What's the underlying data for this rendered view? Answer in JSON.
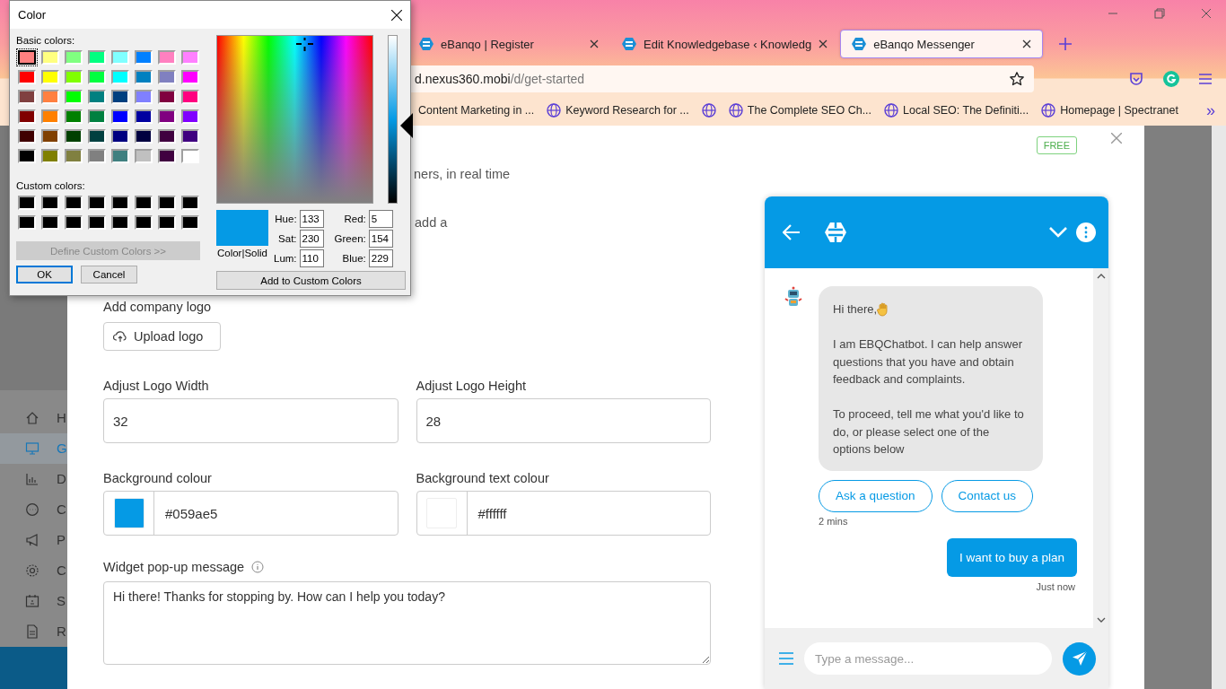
{
  "browser": {
    "tabs": [
      {
        "title": "eBanqo | Register",
        "selected": false
      },
      {
        "title": "Edit Knowledgebase ‹ Knowledg",
        "selected": false
      },
      {
        "title": "eBanqo Messenger",
        "selected": true
      }
    ],
    "address": {
      "host": "d.nexus360.mobi",
      "path": "/d/get-started"
    },
    "bookmarks": [
      {
        "kind": "text",
        "label": "Content Marketing in ..."
      },
      {
        "kind": "globe",
        "label": "Keyword Research for ..."
      },
      {
        "kind": "globe-only"
      },
      {
        "kind": "globe",
        "label": "The Complete SEO Ch..."
      },
      {
        "kind": "globe",
        "label": "Local SEO: The Definiti..."
      },
      {
        "kind": "globe",
        "label": "Homepage | Spectranet"
      }
    ],
    "overflow": "»"
  },
  "sidebar": {
    "items": [
      {
        "label": "H",
        "selected": false
      },
      {
        "label": "G",
        "selected": true
      },
      {
        "label": "D",
        "selected": false
      },
      {
        "label": "C",
        "selected": false
      },
      {
        "label": "P",
        "selected": false
      },
      {
        "label": "C",
        "selected": false
      },
      {
        "label": "S",
        "selected": false
      },
      {
        "label": "R",
        "selected": false
      }
    ]
  },
  "modal": {
    "badge": "FREE",
    "intro_fragments": [
      "ners, in real time",
      "add a"
    ],
    "logo_label": "Add company logo",
    "upload_button": "Upload logo",
    "size_fields": [
      {
        "label": "Adjust Logo Width",
        "value": "32"
      },
      {
        "label": "Adjust Logo Height",
        "value": "28"
      }
    ],
    "color_fields": [
      {
        "label": "Background colour",
        "value": "#059ae5",
        "color": "#059ae5"
      },
      {
        "label": "Background text colour",
        "value": "#ffffff",
        "color": "#ffffff"
      }
    ],
    "message_field": {
      "label": "Widget pop-up message",
      "value": "Hi there! Thanks for stopping by. How can I help you today?"
    }
  },
  "chat": {
    "bot_message": [
      "Hi there,",
      "I am EBQChatbot. I can help answer questions that you have and obtain feedback and complaints.",
      "To proceed, tell me what you'd like to do, or please select one of the options below"
    ],
    "quick_replies": [
      "Ask a question",
      "Contact us"
    ],
    "bot_time": "2 mins",
    "user_message": "I want to buy a plan",
    "user_time": "Just now",
    "input": {
      "placeholder": "Type a message..."
    }
  },
  "color_dialog": {
    "title": "Color",
    "basic_label": "Basic colors:",
    "basic_colors": [
      {
        "color": "#ff8080",
        "selected": true
      },
      {
        "color": "#ffff80",
        "selected": false
      },
      {
        "color": "#80ff80",
        "selected": false
      },
      {
        "color": "#00ff80",
        "selected": false
      },
      {
        "color": "#80ffff",
        "selected": false
      },
      {
        "color": "#0080ff",
        "selected": false
      },
      {
        "color": "#ff80c0",
        "selected": false
      },
      {
        "color": "#ff80ff",
        "selected": false
      },
      {
        "color": "#ff0000",
        "selected": false
      },
      {
        "color": "#ffff00",
        "selected": false
      },
      {
        "color": "#80ff00",
        "selected": false
      },
      {
        "color": "#00ff40",
        "selected": false
      },
      {
        "color": "#00ffff",
        "selected": false
      },
      {
        "color": "#0080c0",
        "selected": false
      },
      {
        "color": "#8080c0",
        "selected": false
      },
      {
        "color": "#ff00ff",
        "selected": false
      },
      {
        "color": "#804040",
        "selected": false
      },
      {
        "color": "#ff8040",
        "selected": false
      },
      {
        "color": "#00ff00",
        "selected": false
      },
      {
        "color": "#008080",
        "selected": false
      },
      {
        "color": "#004080",
        "selected": false
      },
      {
        "color": "#8080ff",
        "selected": false
      },
      {
        "color": "#800040",
        "selected": false
      },
      {
        "color": "#ff0080",
        "selected": false
      },
      {
        "color": "#800000",
        "selected": false
      },
      {
        "color": "#ff8000",
        "selected": false
      },
      {
        "color": "#008000",
        "selected": false
      },
      {
        "color": "#008040",
        "selected": false
      },
      {
        "color": "#0000ff",
        "selected": false
      },
      {
        "color": "#0000a0",
        "selected": false
      },
      {
        "color": "#800080",
        "selected": false
      },
      {
        "color": "#8000ff",
        "selected": false
      },
      {
        "color": "#400000",
        "selected": false
      },
      {
        "color": "#804000",
        "selected": false
      },
      {
        "color": "#004000",
        "selected": false
      },
      {
        "color": "#004040",
        "selected": false
      },
      {
        "color": "#000080",
        "selected": false
      },
      {
        "color": "#000040",
        "selected": false
      },
      {
        "color": "#400040",
        "selected": false
      },
      {
        "color": "#400080",
        "selected": false
      },
      {
        "color": "#000000",
        "selected": false
      },
      {
        "color": "#808000",
        "selected": false
      },
      {
        "color": "#808040",
        "selected": false
      },
      {
        "color": "#808080",
        "selected": false
      },
      {
        "color": "#408080",
        "selected": false
      },
      {
        "color": "#c0c0c0",
        "selected": false
      },
      {
        "color": "#400040",
        "selected": false
      },
      {
        "color": "#ffffff",
        "selected": false
      }
    ],
    "custom_label": "Custom colors:",
    "custom_colors": [
      {
        "color": "#000000"
      },
      {
        "color": "#000000"
      },
      {
        "color": "#000000"
      },
      {
        "color": "#000000"
      },
      {
        "color": "#000000"
      },
      {
        "color": "#000000"
      },
      {
        "color": "#000000"
      },
      {
        "color": "#000000"
      },
      {
        "color": "#000000"
      },
      {
        "color": "#000000"
      },
      {
        "color": "#000000"
      },
      {
        "color": "#000000"
      },
      {
        "color": "#000000"
      },
      {
        "color": "#000000"
      },
      {
        "color": "#000000"
      },
      {
        "color": "#000000"
      }
    ],
    "define_button": {
      "label": "Define Custom Colors >>",
      "disabled": true
    },
    "ok_button": "OK",
    "cancel_button": "Cancel",
    "luminance": {
      "level": 0.46
    },
    "preview": {
      "color": "#059ae5",
      "label": "Color|Solid"
    },
    "hsl_fields": [
      {
        "label": "Hue:",
        "value": "133"
      },
      {
        "label": "Sat:",
        "value": "230"
      },
      {
        "label": "Lum:",
        "value": "110"
      }
    ],
    "rgb_fields": [
      {
        "label": "Red:",
        "value": "5"
      },
      {
        "label": "Green:",
        "value": "154"
      },
      {
        "label": "Blue:",
        "value": "229"
      }
    ],
    "add_button": "Add to Custom Colors"
  }
}
